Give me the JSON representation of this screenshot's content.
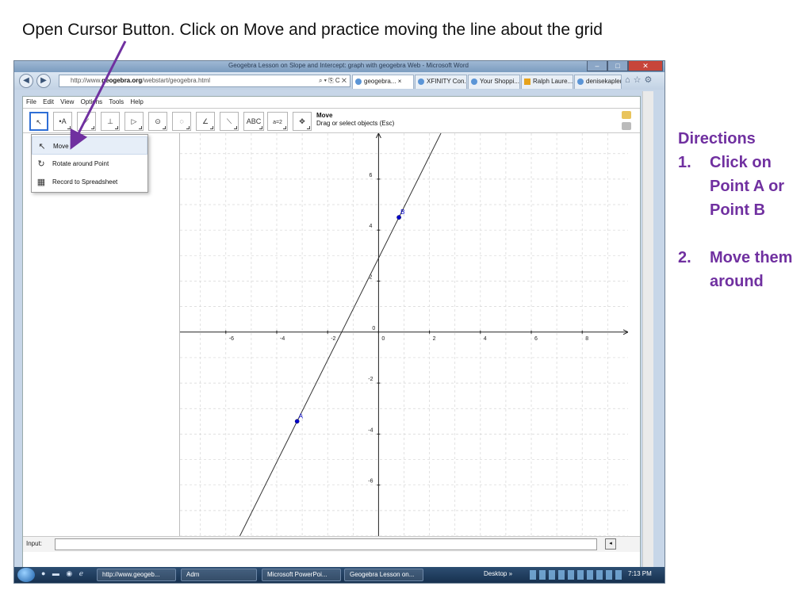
{
  "slide": {
    "title": "Open Cursor Button.  Click on Move and practice moving the line about the grid",
    "directions_heading": "Directions",
    "directions": [
      {
        "num": "1.",
        "text": "Click on Point A or Point B"
      },
      {
        "num": "2.",
        "text": "Move them around"
      }
    ],
    "colors": {
      "directions": "#7030a0",
      "arrow": "#7030a0"
    }
  },
  "browser": {
    "window_title": "Geogebra Lesson on Slope and Intercept: graph with geogebra Web - Microsoft Word",
    "address_prefix": "http://www.",
    "address_domain": "geogebra.org",
    "address_path": "/webstart/geogebra.html",
    "address_controls": "⌕ ▾ ⎘ C ✕",
    "tabs": [
      {
        "label": "geogebra... ×",
        "active": true
      },
      {
        "label": "XFINITY Con...",
        "active": false
      },
      {
        "label": "Your Shoppi...",
        "active": false
      },
      {
        "label": "Ralph Laure...",
        "active": false
      },
      {
        "label": "denisekapler...",
        "active": false
      }
    ],
    "right_icons": "⌂☆⚙"
  },
  "geogebra": {
    "menu": [
      "File",
      "Edit",
      "View",
      "Options",
      "Tools",
      "Help"
    ],
    "tool_info": {
      "name": "Move",
      "hint": "Drag or select objects (Esc)"
    },
    "tools": [
      {
        "name": "move-tool",
        "glyph": "↖"
      },
      {
        "name": "point-tool",
        "glyph": "•A"
      },
      {
        "name": "line-tool",
        "glyph": "⟋"
      },
      {
        "name": "perpendicular-tool",
        "glyph": "⊥"
      },
      {
        "name": "polygon-tool",
        "glyph": "▷"
      },
      {
        "name": "circle-tool",
        "glyph": "⊙"
      },
      {
        "name": "ellipse-tool",
        "glyph": "◌"
      },
      {
        "name": "angle-tool",
        "glyph": "∠"
      },
      {
        "name": "reflect-tool",
        "glyph": "⟍"
      },
      {
        "name": "text-tool",
        "glyph": "ABC"
      },
      {
        "name": "slider-tool",
        "glyph": "a=2"
      },
      {
        "name": "move-graphics-tool",
        "glyph": "✥"
      }
    ],
    "move_menu": [
      {
        "label": "Move",
        "icon": "↖"
      },
      {
        "label": "Rotate around Point",
        "icon": "↻"
      },
      {
        "label": "Record to Spreadsheet",
        "icon": "▦"
      }
    ],
    "input_label": "Input:",
    "input_button": "◂"
  },
  "taskbar": {
    "items": [
      "http://www.geogeb...",
      "Adm",
      "Microsoft PowerPoi...",
      "Geogebra Lesson on..."
    ],
    "desktop": "Desktop  »",
    "clock": "7:13 PM"
  },
  "chart_data": {
    "type": "line",
    "xlim": [
      -7.8,
      9.8
    ],
    "ylim": [
      -8,
      7.8
    ],
    "x_ticks": [
      -6,
      -4,
      -2,
      0,
      2,
      4,
      6,
      8
    ],
    "y_ticks": [
      -6,
      -4,
      -2,
      2,
      4,
      6
    ],
    "origin_label": "0",
    "grid": true,
    "points": [
      {
        "label": "A",
        "x": -3.2,
        "y": -3.5
      },
      {
        "label": "B",
        "x": 0.8,
        "y": 4.5
      }
    ],
    "line_through": [
      "A",
      "B"
    ],
    "point_color": "#0000cc"
  }
}
